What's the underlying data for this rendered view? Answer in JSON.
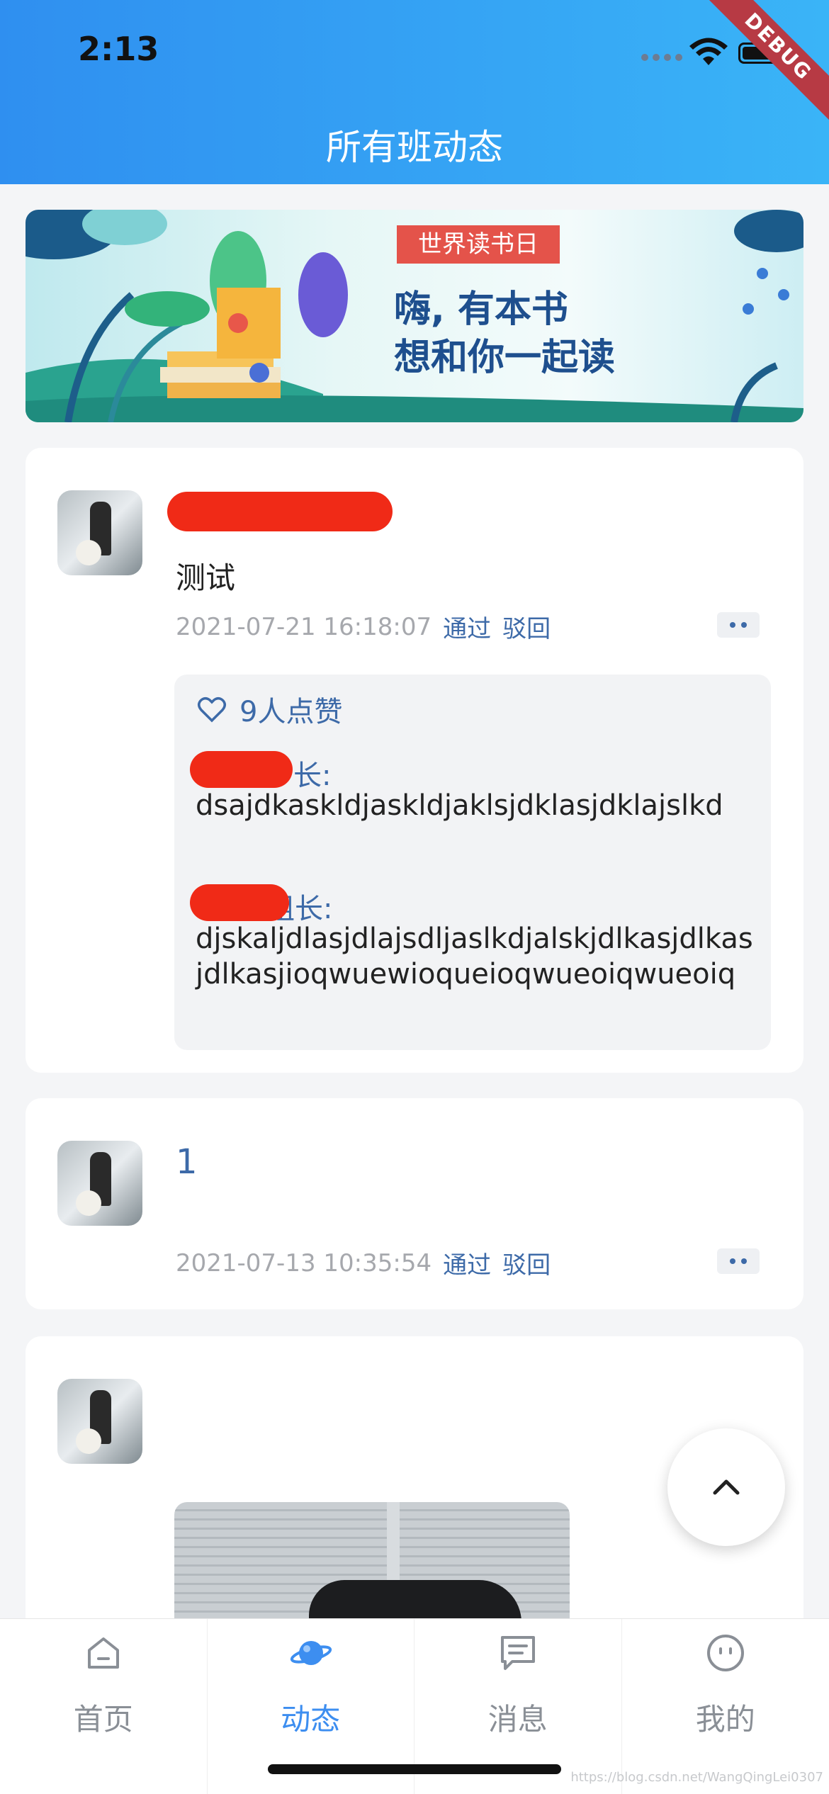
{
  "status_bar": {
    "time": "2:13",
    "debug_label": "DEBUG"
  },
  "header": {
    "title": "所有班动态"
  },
  "banner": {
    "tag": "世界读书日",
    "line1": "嗨, 有本书",
    "line2": "想和你一起读"
  },
  "posts": [
    {
      "text": "测试",
      "timestamp": "2021-07-21 16:18:07",
      "approve_label": "通过",
      "reject_label": "驳回",
      "likes": "9人点赞",
      "comments": [
        {
          "name_suffix": "长:",
          "text": "dsajdkaskldjaskldjaklsjdklasjdklajslkd"
        },
        {
          "name_suffix": "组长:",
          "text": "djskaljdlasjdlajsdljaslkdjalskjdlkasjdlkasjdlkasjioqwuewioqueioqwueoiqwueoiq"
        }
      ]
    },
    {
      "text": "1",
      "timestamp": "2021-07-13 10:35:54",
      "approve_label": "通过",
      "reject_label": "驳回"
    }
  ],
  "tabbar": {
    "items": [
      {
        "label": "首页",
        "icon": "home-icon",
        "active": false
      },
      {
        "label": "动态",
        "icon": "planet-icon",
        "active": true
      },
      {
        "label": "消息",
        "icon": "message-icon",
        "active": false
      },
      {
        "label": "我的",
        "icon": "smile-icon",
        "active": false
      }
    ]
  },
  "colors": {
    "header_start": "#2f8ff0",
    "header_end": "#3ab4f7",
    "accent": "#3d8ef0",
    "link": "#3d6aa8"
  },
  "watermark": "https://blog.csdn.net/WangQingLei0307"
}
